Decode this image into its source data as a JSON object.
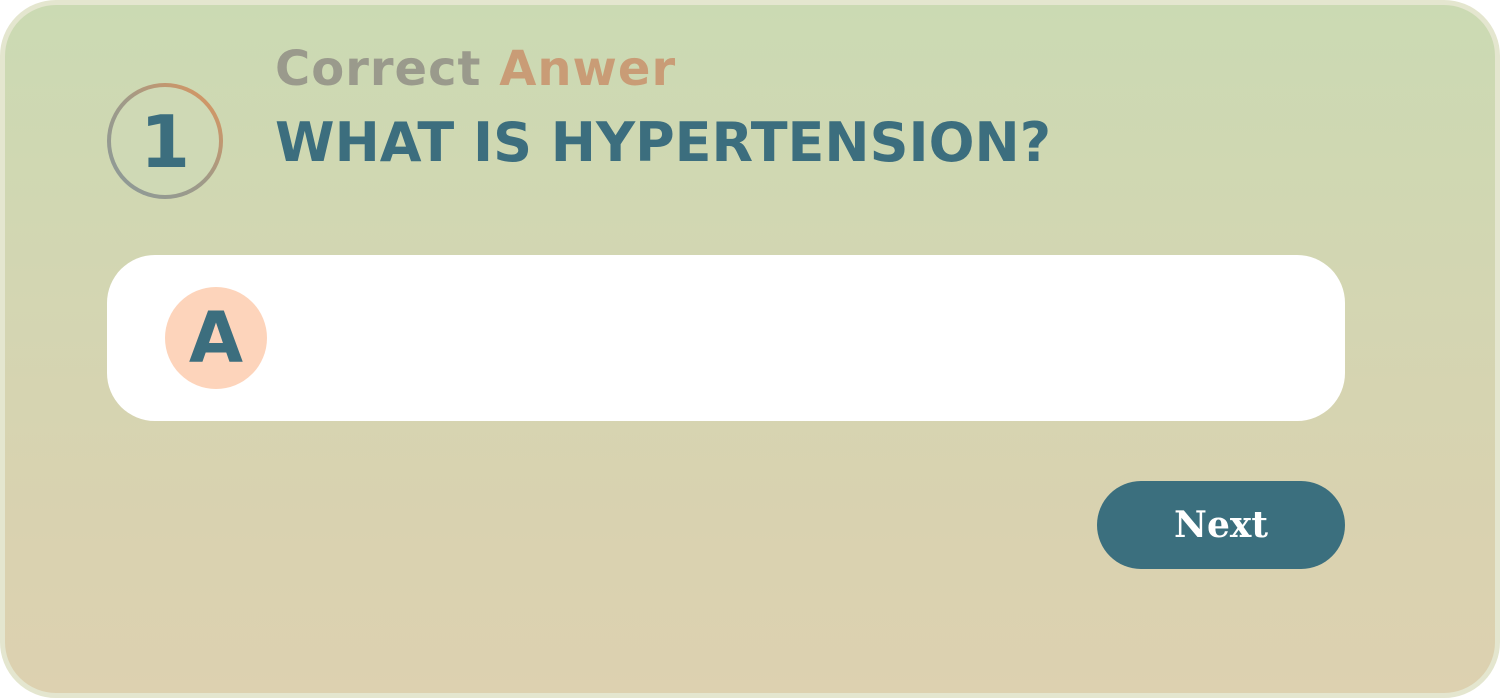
{
  "quiz": {
    "question_number": "1",
    "subtitle_part1": "Correct",
    "subtitle_part2": "Anwer",
    "question": "WHAT IS HYPERTENSION?",
    "answer": {
      "letter": "A",
      "text": ""
    },
    "next_label": "Next"
  },
  "colors": {
    "primary": "#3c6e7e",
    "accent": "#e39559",
    "answer_badge": "#fdd4bb",
    "card_top": "#cbdab3",
    "card_bottom": "#ddd1b0"
  }
}
